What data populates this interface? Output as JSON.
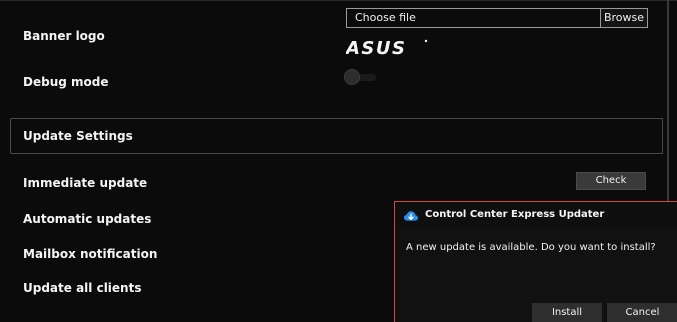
{
  "settings": {
    "banner_logo_label": "Banner logo",
    "file_picker": {
      "placeholder": "Choose file",
      "browse_label": "Browse"
    },
    "logo_text": "ASUS",
    "debug_mode_label": "Debug mode",
    "debug_mode_enabled": false
  },
  "update_settings": {
    "section_title": "Update Settings",
    "immediate_update_label": "Immediate update",
    "check_button_label": "Check",
    "automatic_updates_label": "Automatic updates",
    "mailbox_notification_label": "Mailbox notification",
    "update_all_clients_label": "Update all clients"
  },
  "dialog": {
    "title": "Control Center Express Updater",
    "message": "A new update is available. Do you want to install?",
    "install_label": "Install",
    "cancel_label": "Cancel"
  },
  "colors": {
    "background": "#0b0b0b",
    "dialog_border": "#d9443b",
    "icon_blue": "#2a8ee8"
  },
  "icons": {
    "dialog_icon": "cloud-download-icon"
  }
}
